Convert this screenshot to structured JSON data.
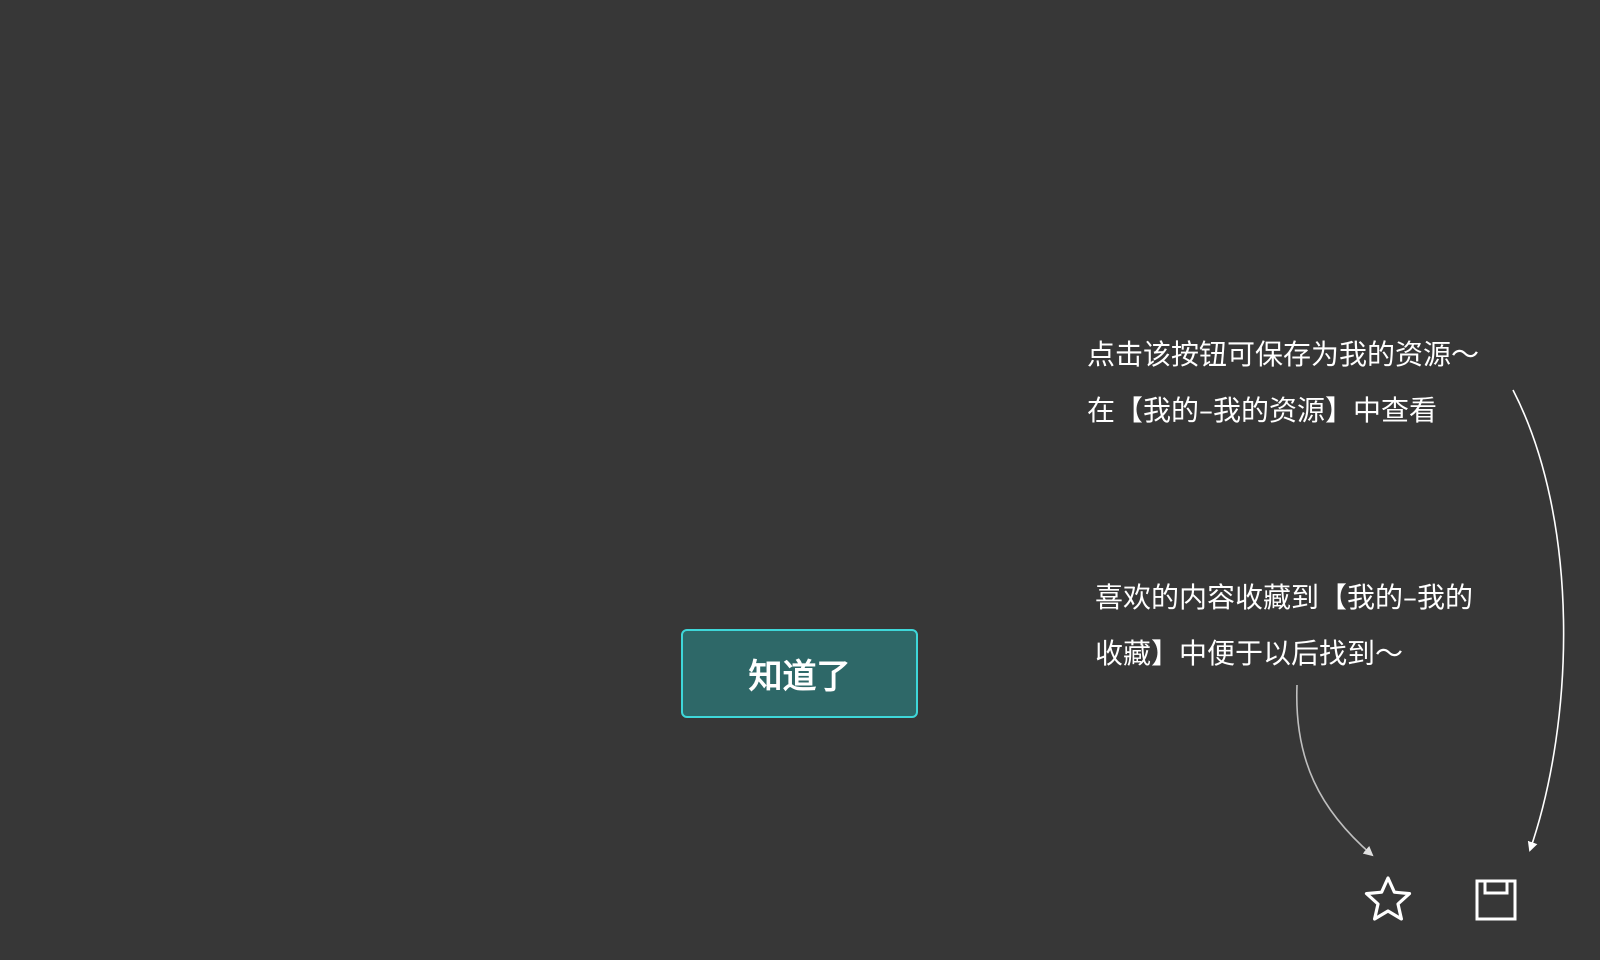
{
  "guide": {
    "save_tip": {
      "line1": "点击该按钮可保存为我的资源～",
      "line2": "在【我的–我的资源】中查看"
    },
    "favorite_tip": {
      "line1": "喜欢的内容收藏到【我的–我的",
      "line2": "收藏】中便于以后找到～"
    },
    "ok_label": "知道了"
  },
  "icons": {
    "favorite": "star-icon",
    "save": "save-icon"
  },
  "colors": {
    "overlay_background": "#373737",
    "button_fill": "#2e6868",
    "button_border": "#3ed7d9",
    "text": "#ffffff"
  }
}
